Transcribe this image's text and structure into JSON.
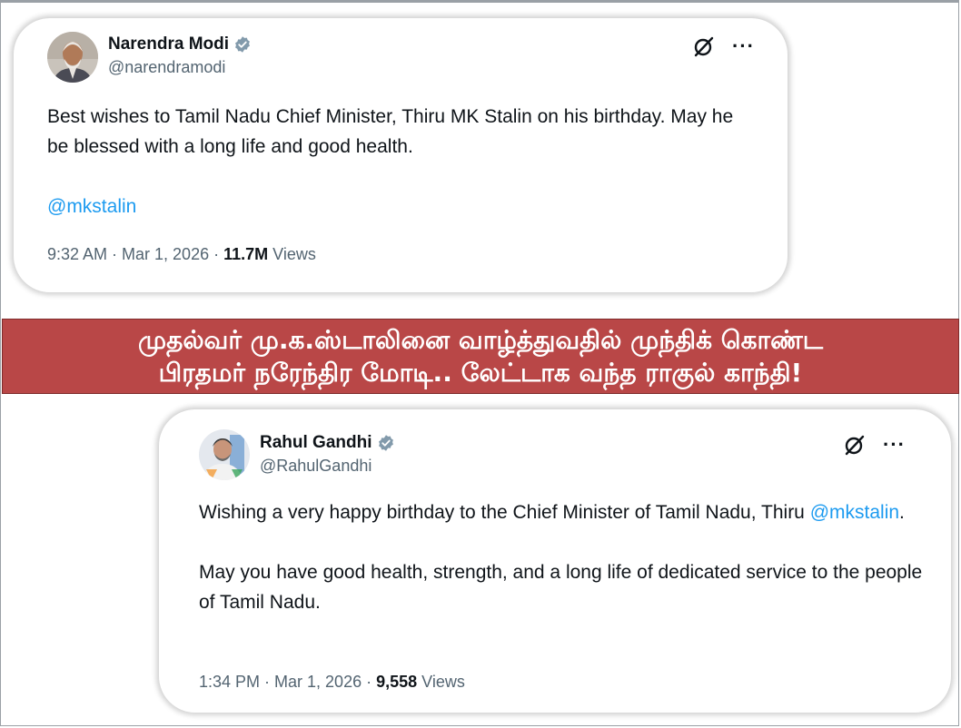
{
  "headline": {
    "line1": "முதல்வர் மு.க.ஸ்டாலினை வாழ்த்துவதில் முந்திக் கொண்ட",
    "line2": "பிரதமர் நரேந்திர மோடி.. லேட்டாக வந்த ராகுல் காந்தி!"
  },
  "tweets": [
    {
      "author": "Narendra Modi",
      "handle": "@narendramodi",
      "text1": "Best wishes to Tamil Nadu Chief Minister, Thiru MK Stalin on his birthday. May he be blessed with a long life and good health.",
      "mention": "@mkstalin",
      "time": "9:32 AM · Mar 1, 2026 · ",
      "views_count": "11.7M",
      "views_label": " Views"
    },
    {
      "author": "Rahul Gandhi",
      "handle": "@RahulGandhi",
      "text1": "Wishing a very happy birthday to the Chief Minister of Tamil Nadu, Thiru ",
      "mention": "@mkstalin",
      "text1_end": ".",
      "text2": "May you have good health, strength, and a long life of dedicated service to the people of Tamil Nadu.",
      "time": "1:34 PM · Mar 1, 2026 · ",
      "views_count": "9,558",
      "views_label": " Views"
    }
  ],
  "icons": {
    "verified": "verified-badge-icon",
    "grok": "grok-icon",
    "more": "more-options-icon"
  },
  "colors": {
    "banner": "#b94747",
    "link": "#1d9bf0",
    "verified": "#829aab"
  }
}
